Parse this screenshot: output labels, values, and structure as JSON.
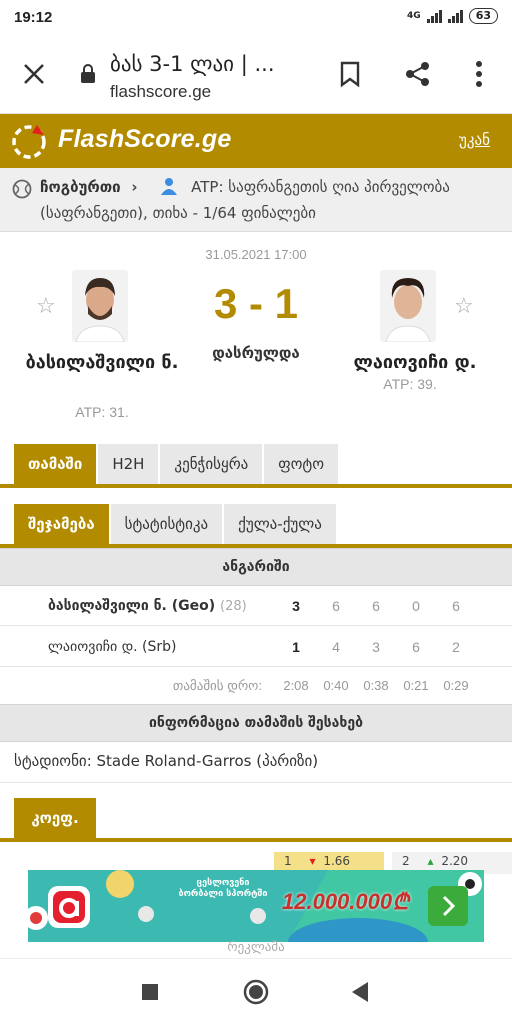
{
  "status_bar": {
    "time": "19:12",
    "network": "4G",
    "battery": "63"
  },
  "browser": {
    "title": "ბას 3-1 ლაი | ...",
    "url": "flashscore.ge"
  },
  "header": {
    "logo": "FlashScore.ge",
    "back_label": "უკან"
  },
  "breadcrumb": {
    "category": "ჩოგბურთი",
    "arrow": "›",
    "tournament": "ATP: საფრანგეთის ღია პირველობა (საფრანგეთი), თიხა - 1/64 ფინალები"
  },
  "match": {
    "datetime": "31.05.2021 17:00",
    "score": "3 - 1",
    "status": "დასრულდა",
    "home": {
      "name": "ბასილაშვილი ნ.",
      "rank": "ATP: 31."
    },
    "away": {
      "name": "ლაიოვიჩი დ.",
      "rank": "ATP: 39."
    }
  },
  "main_tabs": [
    "თამაში",
    "H2H",
    "კენჭისყრა",
    "ფოტო"
  ],
  "sub_tabs": [
    "შეჯამება",
    "სტატისტიკა",
    "ქულა-ქულა"
  ],
  "scoreboard": {
    "title": "ანგარიში",
    "home": {
      "name": "ბასილაშვილი ნ. (Geo)",
      "seed": "(28)",
      "total": "3",
      "sets": [
        "6",
        "6",
        "0",
        "6"
      ]
    },
    "away": {
      "name": "ლაიოვიჩი დ. (Srb)",
      "total": "1",
      "sets": [
        "4",
        "3",
        "6",
        "2"
      ]
    },
    "duration_label": "თამაშის დრო:",
    "durations": [
      "2:08",
      "0:40",
      "0:38",
      "0:21",
      "0:29"
    ]
  },
  "info": {
    "title": "ინფორმაცია თამაშის შესახებ",
    "venue": "სტადიონი: Stade Roland-Garros (პარიზი)"
  },
  "odds": {
    "tab_label": "კოეფ.",
    "o1_label": "1",
    "o1_value": "1.66",
    "o2_label": "2",
    "o2_value": "2.20"
  },
  "ad": {
    "amount": "12.000.000₾",
    "label": "რეკლამა",
    "brand": "ცესლოვენი ბორბალი სპორტში"
  },
  "colors": {
    "brand": "#b28b00",
    "ad_bg": "#3cb9b0",
    "odds_bg": "#f5e08a"
  }
}
